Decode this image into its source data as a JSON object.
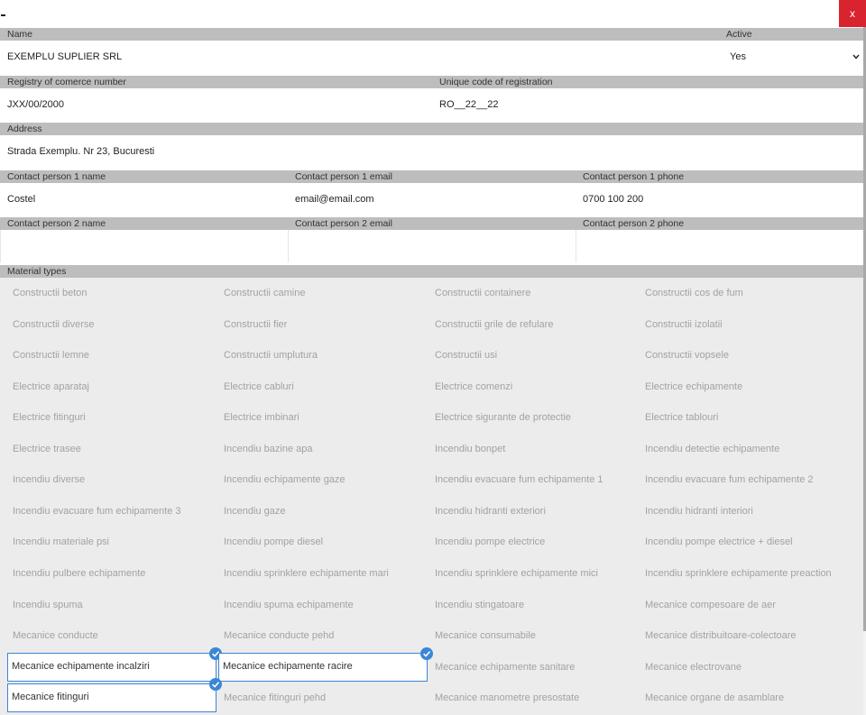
{
  "window": {
    "close_label": "x"
  },
  "fields": {
    "name": {
      "label": "Name",
      "value": "EXEMPLU SUPLIER SRL"
    },
    "active": {
      "label": "Active",
      "value": "Yes"
    },
    "registry": {
      "label": "Registry of comerce number",
      "value": "JXX/00/2000"
    },
    "unique_code": {
      "label": "Unique code of registration",
      "value": "RO__22__22"
    },
    "address": {
      "label": "Address",
      "value": "Strada Exemplu. Nr 23, Bucuresti"
    },
    "cp1_name": {
      "label": "Contact person 1 name",
      "value": "Costel"
    },
    "cp1_email": {
      "label": "Contact person 1 email",
      "value": "email@email.com"
    },
    "cp1_phone": {
      "label": "Contact person 1 phone",
      "value": "0700 100 200"
    },
    "cp2_name": {
      "label": "Contact person 2 name",
      "value": ""
    },
    "cp2_email": {
      "label": "Contact person 2 email",
      "value": ""
    },
    "cp2_phone": {
      "label": "Contact person 2 phone",
      "value": ""
    }
  },
  "material_types": {
    "label": "Material types",
    "items": [
      {
        "label": "Constructii beton",
        "selected": false
      },
      {
        "label": "Constructii camine",
        "selected": false
      },
      {
        "label": "Constructii containere",
        "selected": false
      },
      {
        "label": "Constructii cos de fum",
        "selected": false
      },
      {
        "label": "Constructii diverse",
        "selected": false
      },
      {
        "label": "Constructii fier",
        "selected": false
      },
      {
        "label": "Constructii grile de refulare",
        "selected": false
      },
      {
        "label": "Constructii izolatii",
        "selected": false
      },
      {
        "label": "Constructii lemne",
        "selected": false
      },
      {
        "label": "Constructii umplutura",
        "selected": false
      },
      {
        "label": "Constructii usi",
        "selected": false
      },
      {
        "label": "Constructii vopsele",
        "selected": false
      },
      {
        "label": "Electrice aparataj",
        "selected": false
      },
      {
        "label": "Electrice cabluri",
        "selected": false
      },
      {
        "label": "Electrice comenzi",
        "selected": false
      },
      {
        "label": "Electrice echipamente",
        "selected": false
      },
      {
        "label": "Electrice fitinguri",
        "selected": false
      },
      {
        "label": "Electrice imbinari",
        "selected": false
      },
      {
        "label": "Electrice sigurante de protectie",
        "selected": false
      },
      {
        "label": "Electrice tablouri",
        "selected": false
      },
      {
        "label": "Electrice trasee",
        "selected": false
      },
      {
        "label": "Incendiu bazine apa",
        "selected": false
      },
      {
        "label": "Incendiu bonpet",
        "selected": false
      },
      {
        "label": "Incendiu detectie echipamente",
        "selected": false
      },
      {
        "label": "Incendiu diverse",
        "selected": false
      },
      {
        "label": "Incendiu echipamente gaze",
        "selected": false
      },
      {
        "label": "Incendiu evacuare fum echipamente 1",
        "selected": false
      },
      {
        "label": "Incendiu evacuare fum echipamente 2",
        "selected": false
      },
      {
        "label": "Incendiu evacuare fum echipamente 3",
        "selected": false
      },
      {
        "label": "Incendiu gaze",
        "selected": false
      },
      {
        "label": "Incendiu hidranti exteriori",
        "selected": false
      },
      {
        "label": "Incendiu hidranti interiori",
        "selected": false
      },
      {
        "label": "Incendiu materiale psi",
        "selected": false
      },
      {
        "label": "Incendiu pompe diesel",
        "selected": false
      },
      {
        "label": "Incendiu pompe electrice",
        "selected": false
      },
      {
        "label": "Incendiu pompe electrice + diesel",
        "selected": false
      },
      {
        "label": "Incendiu pulbere echipamente",
        "selected": false
      },
      {
        "label": "Incendiu sprinklere echipamente mari",
        "selected": false
      },
      {
        "label": "Incendiu sprinklere echipamente mici",
        "selected": false
      },
      {
        "label": "Incendiu sprinklere echipamente preaction",
        "selected": false
      },
      {
        "label": "Incendiu spuma",
        "selected": false
      },
      {
        "label": "Incendiu spuma echipamente",
        "selected": false
      },
      {
        "label": "Incendiu stingatoare",
        "selected": false
      },
      {
        "label": "Mecanice compesoare de aer",
        "selected": false
      },
      {
        "label": "Mecanice conducte",
        "selected": false
      },
      {
        "label": "Mecanice conducte pehd",
        "selected": false
      },
      {
        "label": "Mecanice consumabile",
        "selected": false
      },
      {
        "label": "Mecanice distribuitoare-colectoare",
        "selected": false
      },
      {
        "label": "Mecanice echipamente incalziri",
        "selected": true
      },
      {
        "label": "Mecanice echipamente racire",
        "selected": true
      },
      {
        "label": "Mecanice echipamente sanitare",
        "selected": false
      },
      {
        "label": "Mecanice electrovane",
        "selected": false
      },
      {
        "label": "Mecanice fitinguri",
        "selected": true
      },
      {
        "label": "Mecanice fitinguri pehd",
        "selected": false
      },
      {
        "label": "Mecanice manometre presostate",
        "selected": false
      },
      {
        "label": "Mecanice organe de asamblare",
        "selected": false
      }
    ]
  }
}
